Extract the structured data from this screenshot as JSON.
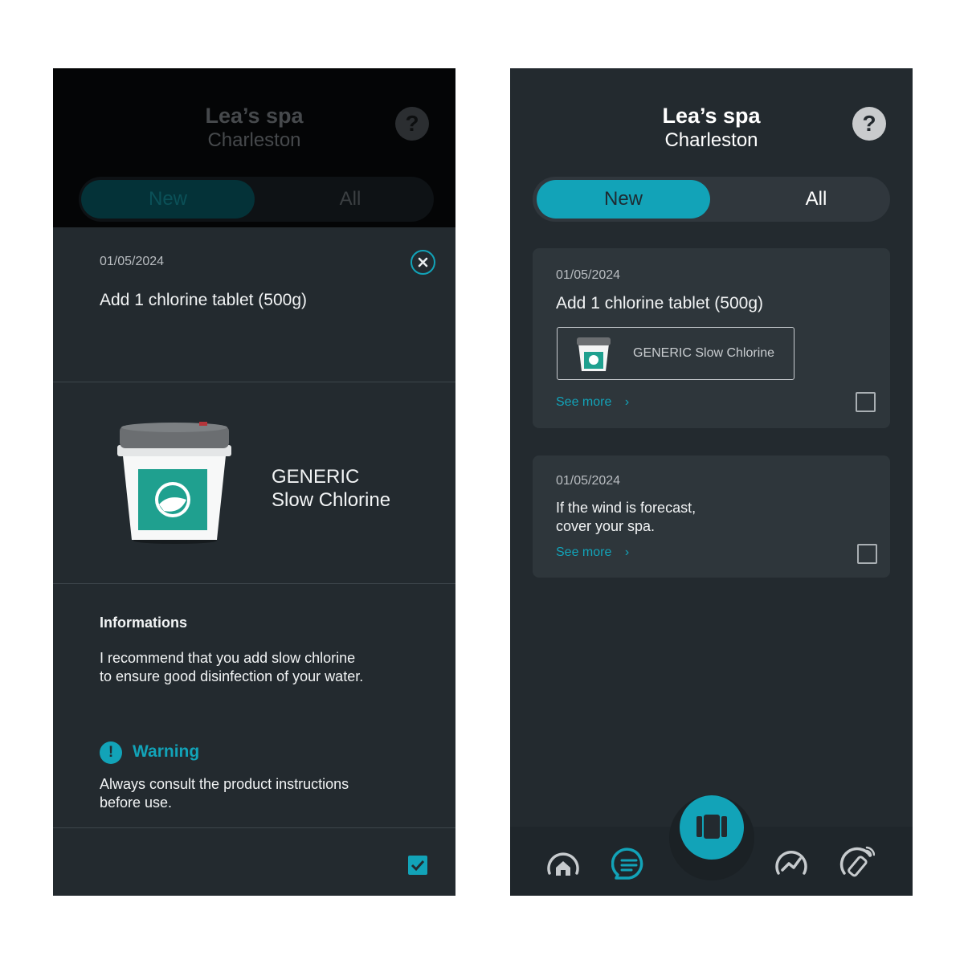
{
  "colors": {
    "accent": "#12a3b8",
    "background": "#232a2f",
    "card": "#2e363b"
  },
  "left": {
    "header": {
      "title": "Lea’s spa",
      "subtitle": "Charleston",
      "help": "?"
    },
    "tabs": {
      "new": "New",
      "all": "All"
    },
    "detail": {
      "date": "01/05/2024",
      "task": "Add 1 chlorine tablet (500g)",
      "product_line1": "GENERIC",
      "product_line2": "Slow Chlorine",
      "info_heading": "Informations",
      "info_line1": "I recommend that you add slow chlorine",
      "info_line2": "to ensure good disinfection of your water.",
      "warning_heading": "Warning",
      "warning_line1": "Always consult the product instructions",
      "warning_line2": "before use.",
      "warning_icon": "!"
    }
  },
  "right": {
    "header": {
      "title": "Lea’s spa",
      "subtitle": "Charleston",
      "help": "?"
    },
    "tabs": {
      "new": "New",
      "all": "All"
    },
    "cards": [
      {
        "date": "01/05/2024",
        "task": "Add 1 chlorine tablet (500g)",
        "product": "GENERIC Slow Chlorine",
        "see_more": "See more",
        "chevron": "›"
      },
      {
        "date": "01/05/2024",
        "task_line1": "If the wind is forecast,",
        "task_line2": "cover your spa.",
        "see_more": "See more",
        "chevron": "›"
      }
    ]
  }
}
